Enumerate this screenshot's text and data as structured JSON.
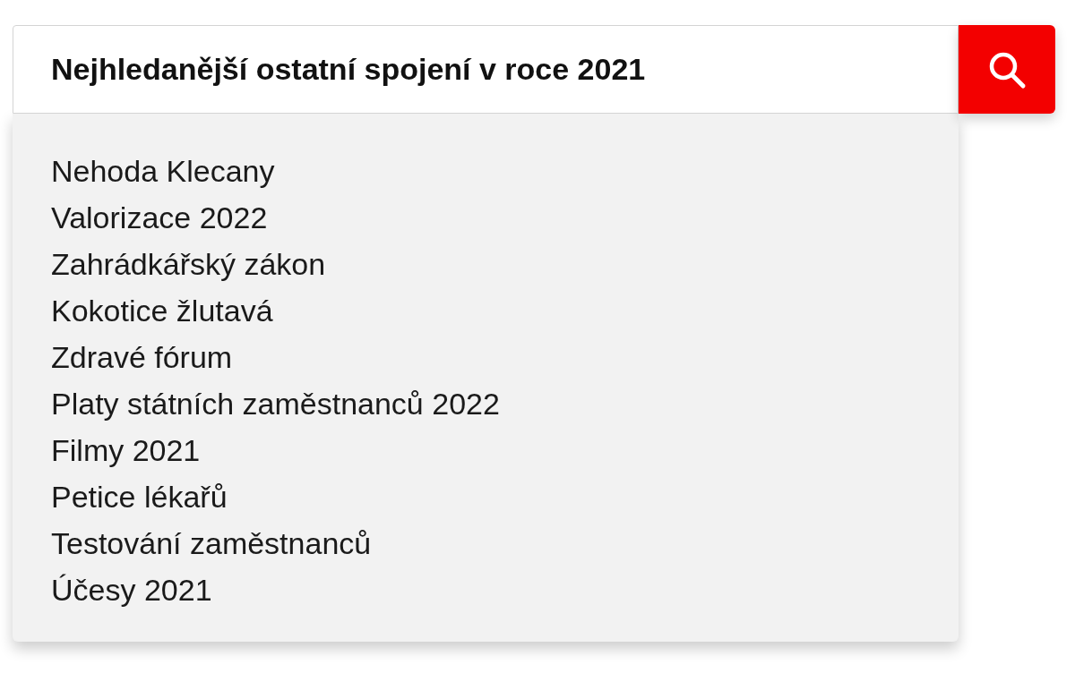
{
  "heading": "Nejhledanější ostatní spojení v roce 2021",
  "items": [
    "Nehoda Klecany",
    "Valorizace 2022",
    "Zahrádkářský zákon",
    "Kokotice žlutavá",
    "Zdravé fórum",
    "Platy státních zaměstnanců 2022",
    "Filmy 2021",
    "Petice lékařů",
    "Testování zaměstnanců",
    "Účesy 2021"
  ]
}
